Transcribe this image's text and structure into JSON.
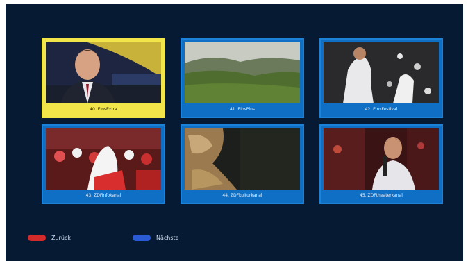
{
  "channels": [
    {
      "label": "40. EinsExtra"
    },
    {
      "label": "41. EinsPlus"
    },
    {
      "label": "42. EinsFestival"
    },
    {
      "label": "43. ZDFinfokanal"
    },
    {
      "label": "44. ZDFkulturkanal"
    },
    {
      "label": "45. ZDFtheaterkanal"
    }
  ],
  "selected_channel": "40. EinsExtra",
  "legend": {
    "back": {
      "label": "Zurück",
      "color": "#d42a2a"
    },
    "next": {
      "label": "Nächste",
      "color": "#2a5ad4"
    }
  },
  "colors": {
    "background": "#061a33",
    "tile_border": "#1b82d8",
    "selected_tile": "#f2e54a"
  }
}
